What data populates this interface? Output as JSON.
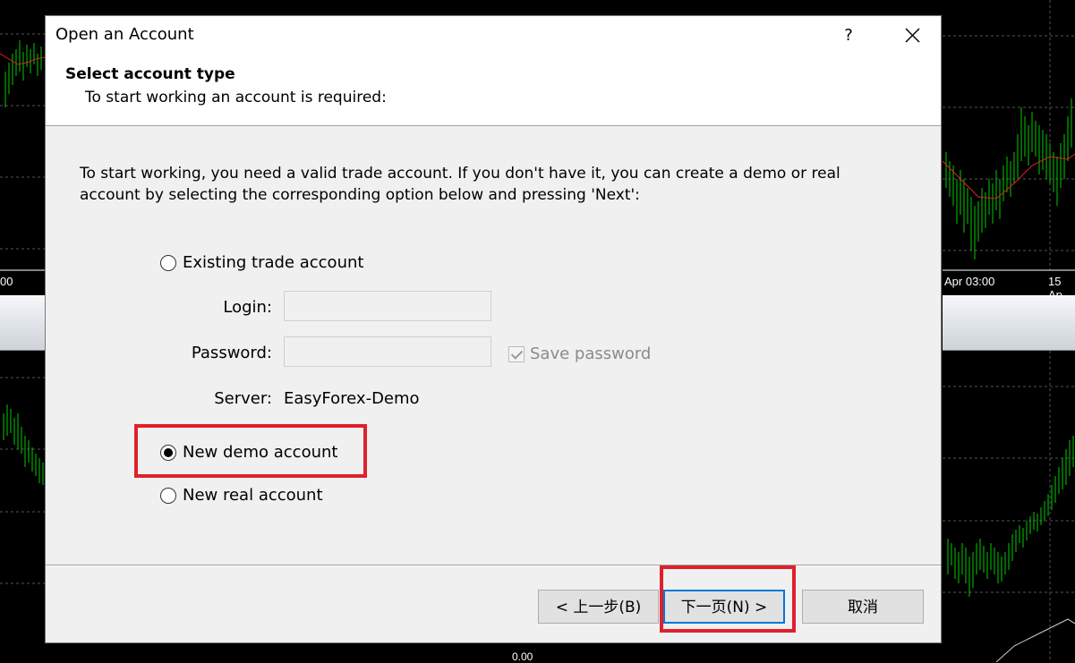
{
  "background": {
    "time_labels": [
      "00",
      "Apr 03:00",
      "15 Ap"
    ],
    "bottom_value": "0.00",
    "accent_colors": {
      "candles": "#00cc00",
      "moving_average": "#e0202a"
    }
  },
  "dialog": {
    "title": "Open an Account",
    "help_label": "?",
    "close_icon": "close-icon",
    "header": {
      "title": "Select account type",
      "subtitle": "To start working an account is required:"
    },
    "description": "To start working, you need a valid trade account. If you don't have it, you can create a demo or real account by selecting the corresponding option below and pressing 'Next':",
    "options": {
      "existing": {
        "label": "Existing trade account",
        "checked": false
      },
      "demo": {
        "label": "New demo account",
        "checked": true
      },
      "real": {
        "label": "New real account",
        "checked": false
      }
    },
    "login": {
      "label": "Login:",
      "value": ""
    },
    "password": {
      "label": "Password:",
      "value": ""
    },
    "save_password": {
      "label": "Save password",
      "checked": true,
      "enabled": false
    },
    "server": {
      "label": "Server:",
      "value": "EasyForex-Demo"
    },
    "buttons": {
      "back": "< 上一步(B)",
      "next": "下一页(N) >",
      "cancel": "取消"
    },
    "annotation_color": "#e0202a"
  }
}
